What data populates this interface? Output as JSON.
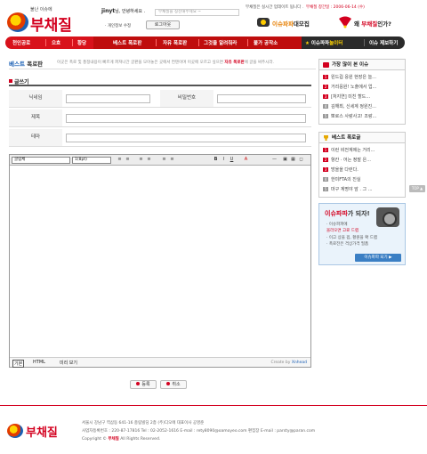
{
  "header": {
    "logo_small": "불난 이슈에",
    "logo_big": "부채질",
    "user_name": "jinyt",
    "greeting": "님, 안녕하세요 .",
    "notice_placeholder": "부채질을 칭찬해주세요 ~",
    "edit_profile": "· 개인정보 수정",
    "logout_label": "로그아웃",
    "top_right_prefix": "부채질은 실시간 업데이트 됩니다 .",
    "top_right_open": "부채질 창간일 : 2006-06-14 (수)",
    "promo1_highlight": "이슈파파",
    "promo1_rest": "대모집",
    "promo2_prefix": "왜",
    "promo2_highlight": "부채질",
    "promo2_rest": "인가?"
  },
  "nav": {
    "left": [
      "천인공로",
      "으흐",
      "황당"
    ],
    "mid": [
      "베스트 폭로판",
      "자유 폭로판",
      "그것을 알려줘라",
      "불가 공작소"
    ],
    "right_badge": "이슈파파",
    "right_badge2": "놀이터",
    "right_last": "이슈 제보하기"
  },
  "side_tab": "TOP ▲",
  "page": {
    "title_main": "베스트",
    "title_rest": "폭로판",
    "desc": "이곳은 폭로 및 풍정내용이 빠르게 퍼져나간 글판을 모아놓은 곳에서 컨텐이며 이곳에 오르고 싶으면",
    "desc_red": "자유 폭로판",
    "desc_end": "에 글을 써주시라."
  },
  "form": {
    "header": "글쓰기",
    "nickname_label": "닉네임",
    "password_label": "비밀번호",
    "subject_label": "제목",
    "theme_label": "테마"
  },
  "editor": {
    "font_select": "굴림체",
    "size_select": "1(8pt)",
    "toolbar_buttons": [
      "≡",
      "≡",
      "≡",
      "≡",
      "≡",
      "≡",
      "B",
      "I",
      "U",
      "A",
      "—",
      "▣",
      "▦",
      "◻"
    ],
    "tabs": [
      "기본",
      "HTML",
      "미리 보기"
    ],
    "credit_prefix": "Create by ",
    "credit_link": "Xnhead"
  },
  "actions": {
    "submit": "등록",
    "cancel": "취소"
  },
  "sidebar": {
    "hot_title": "가장 많이 본 이슈",
    "hot_items": [
      "왼드컵 응원 현장은 늘...",
      "거리응원! 노출에서 업...",
      "[처지연] 미친 할드...",
      "김해최, 신세계 정원진...",
      "뽀로스 사랑사고! 조랑..."
    ],
    "best_title": "베스트 폭로글",
    "best_items": [
      "이런 비전계에는 거리...",
      "항칸 · 어는 정말 은...",
      "방을을 다런다.",
      "한미FTA의 진실",
      "마구 계명야 앞 . 그 ..."
    ],
    "ad_title_red": "이슈파파",
    "ad_title_rest": "가 되자!",
    "ad_lines": [
      "· 이슈파파에",
      "올라오면 고료 드랩",
      "· 이고 상을 핍, 황원을 확 드랩",
      "· 폭로전은 격상가격 필품"
    ],
    "ad_button": "이슈파파 되기 ▶"
  },
  "footer": {
    "logo_text": "부채질",
    "line1": "서울시 강남구 역삼동 641-16 충림빌딩 2층 (주)디오에 대표이사 공영준",
    "line2": "사업자등록번호 : 220-87-17816   Tel : 02-2052-1616   E-mail : rety8090@oamoyeo.com   편집장 E-mail : parsty@paran.com",
    "line3_prefix": "Copyright ©",
    "line3_brand": "부채질",
    "line3_rest": "All Rights Reserved."
  },
  "colors": {
    "brand_red": "#d3001f",
    "nav_red": "#bf0d0d",
    "nav_dark": "#2b2b2b",
    "link_blue": "#1a5fb4"
  }
}
